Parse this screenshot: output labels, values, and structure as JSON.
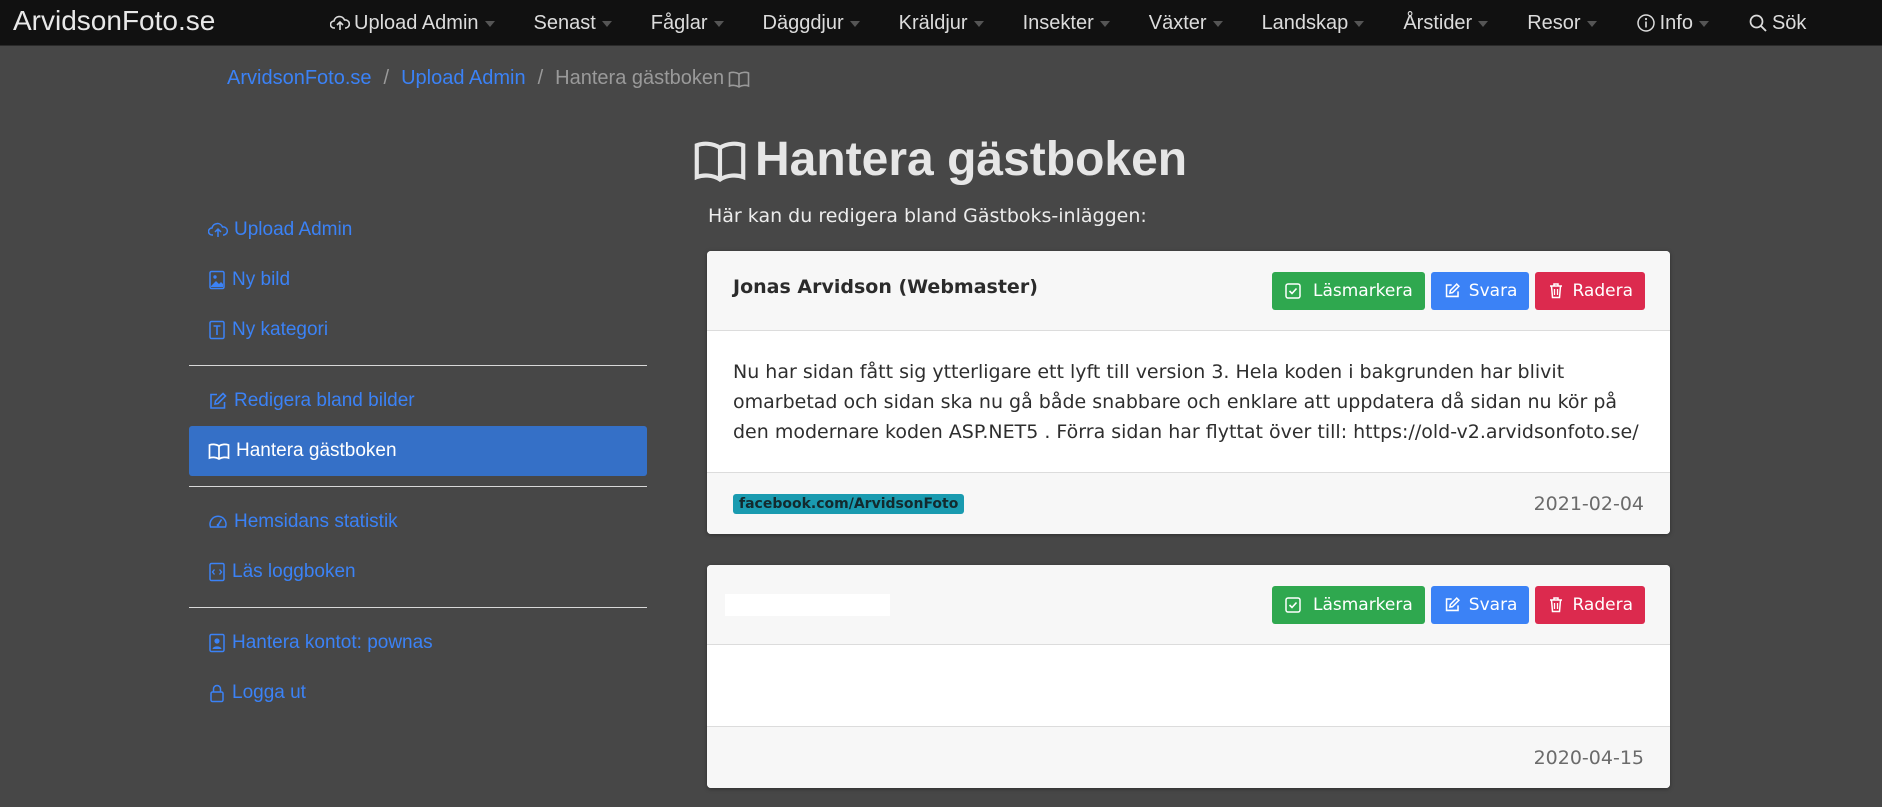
{
  "brand": "ArvidsonFoto.se",
  "nav": {
    "items": [
      {
        "label": "Upload Admin",
        "icon": "cloud-upload-icon",
        "caret": true
      },
      {
        "label": "Senast",
        "caret": true
      },
      {
        "label": "Fåglar",
        "caret": true
      },
      {
        "label": "Däggdjur",
        "caret": true
      },
      {
        "label": "Kräldjur",
        "caret": true
      },
      {
        "label": "Insekter",
        "caret": true
      },
      {
        "label": "Växter",
        "caret": true
      },
      {
        "label": "Landskap",
        "caret": true
      },
      {
        "label": "Årstider",
        "caret": true
      },
      {
        "label": "Resor",
        "caret": true
      },
      {
        "label": "Info",
        "icon": "info-icon",
        "caret": true
      },
      {
        "label": "Sök",
        "icon": "search-icon",
        "caret": false
      }
    ]
  },
  "breadcrumb": {
    "home": "ArvidsonFoto.se",
    "section": "Upload Admin",
    "current": "Hantera gästboken"
  },
  "sidebar": {
    "items": [
      {
        "label": "Upload Admin",
        "icon": "cloud-upload-icon"
      },
      {
        "label": "Ny bild",
        "icon": "image-icon"
      },
      {
        "label": "Ny kategori",
        "icon": "text-box-icon"
      },
      {
        "label": "Redigera bland bilder",
        "icon": "edit-icon"
      },
      {
        "label": "Hantera gästboken",
        "icon": "book-icon",
        "active": true
      },
      {
        "label": "Hemsidans statistik",
        "icon": "speedometer-icon"
      },
      {
        "label": "Läs loggboken",
        "icon": "log-file-icon"
      },
      {
        "label": "Hantera kontot: pownas",
        "icon": "account-icon"
      },
      {
        "label": "Logga ut",
        "icon": "lock-icon"
      }
    ]
  },
  "main": {
    "title": "Hantera gästboken",
    "intro": "Här kan du redigera bland Gästboks-inläggen:",
    "buttons": {
      "mark_read": "Läsmarkera",
      "reply": "Svara",
      "delete": "Radera"
    },
    "posts": [
      {
        "author": "Jonas Arvidson (Webmaster)",
        "message": "Nu har sidan fått sig ytterligare ett lyft till version 3. Hela koden i bakgrunden har blivit omarbetad och sidan ska nu gå både snabbare och enklare att uppdatera då sidan nu kör på den modernare koden ASP.NET5 . Förra sidan har flyttat över till: https://old-v2.arvidsonfoto.se/",
        "tag": "facebook.com/ArvidsonFoto",
        "date": "2021-02-04"
      },
      {
        "author": "",
        "message": "",
        "tag": "",
        "date": "2020-04-15"
      }
    ]
  },
  "colors": {
    "background": "#474747",
    "navbar": "#111111",
    "link": "#3b82f6",
    "active": "#3570c7",
    "green": "#2fa84f",
    "blue": "#3b82f6",
    "red": "#dc2a4e"
  }
}
